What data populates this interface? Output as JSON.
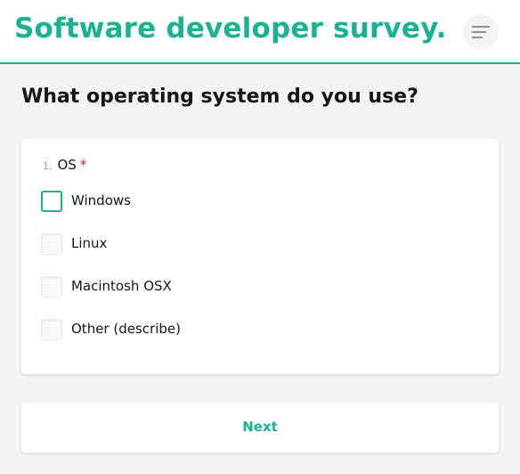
{
  "header": {
    "title": "Software developer survey.",
    "menu_icon": "hamburger-menu-icon"
  },
  "page": {
    "question_heading": "What operating system do you use?"
  },
  "question": {
    "number": "1.",
    "title": "OS",
    "required_mark": "*",
    "choices": [
      {
        "label": "Windows",
        "checked": false,
        "focused": true
      },
      {
        "label": "Linux",
        "checked": false,
        "focused": false
      },
      {
        "label": "Macintosh OSX",
        "checked": false,
        "focused": false
      },
      {
        "label": "Other (describe)",
        "checked": false,
        "focused": false
      }
    ]
  },
  "navigation": {
    "next_label": "Next"
  },
  "colors": {
    "accent": "#19b394",
    "required": "#e60a3e",
    "background": "#f3f3f3"
  }
}
